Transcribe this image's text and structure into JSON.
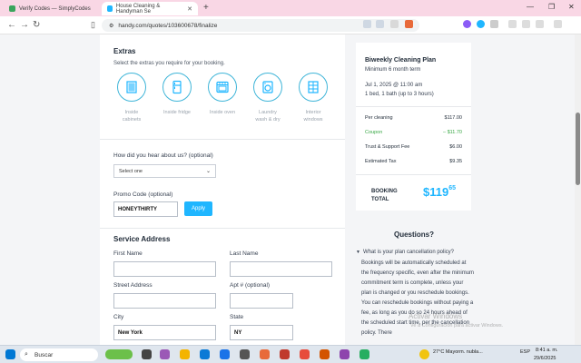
{
  "browser": {
    "tabs": [
      {
        "title": "Verify Codes — SimplyCodes",
        "active": false
      },
      {
        "title": "House Cleaning & Handyman Se",
        "active": true
      }
    ],
    "url": "handy.com/quotes/103600678/finalize"
  },
  "extras": {
    "title": "Extras",
    "subtitle": "Select the extras you require for your booking.",
    "items": [
      {
        "label": "Inside cabinets",
        "icon": "cabinet-icon"
      },
      {
        "label": "Inside fridge",
        "icon": "fridge-icon"
      },
      {
        "label": "Inside oven",
        "icon": "oven-icon"
      },
      {
        "label": "Laundry wash & dry",
        "icon": "laundry-icon"
      },
      {
        "label": "Interior windows",
        "icon": "window-icon"
      }
    ]
  },
  "hear": {
    "label": "How did you hear about us? (optional)",
    "selected": "Select one"
  },
  "promo": {
    "label": "Promo Code (optional)",
    "value": "HONEYTHIRTY",
    "apply": "Apply"
  },
  "service": {
    "title": "Service Address",
    "first_name": "First Name",
    "last_name": "Last Name",
    "street": "Street Address",
    "apt": "Apt # (optional)",
    "city": "City",
    "city_value": "New York",
    "state": "State",
    "state_value": "NY"
  },
  "summary": {
    "plan": "Biweekly Cleaning Plan",
    "term": "Minimum 6 month term",
    "date": "Jul 1, 2025 @ 11:00 am",
    "size": "1 bed, 1 bath (up to 3 hours)",
    "lines": [
      {
        "label": "Per cleaning",
        "value": "$117.00"
      },
      {
        "label": "Coupon",
        "value": "– $11.70"
      },
      {
        "label": "Trust & Support Fee",
        "value": "$6.00"
      },
      {
        "label": "Estimated Tax",
        "value": "$9.35"
      }
    ],
    "total_label_1": "BOOKING",
    "total_label_2": "TOTAL",
    "total_dollars": "$119",
    "total_cents": "65"
  },
  "questions": {
    "title": "Questions?",
    "q1": "What is your plan cancellation policy?",
    "a1": "Bookings will be automatically scheduled at the frequency specific, even after the minimum commitment term is complete, unless your plan is changed or you reschedule bookings. You can reschedule bookings without paying a fee, as long as you do so 24 hours ahead of the scheduled start time, per the cancellation policy. There"
  },
  "watermark": {
    "line1": "Activar Windows",
    "line2": "Ve a Configuración para activar Windows."
  },
  "taskbar": {
    "search": "Buscar",
    "weather": "27°C  Mayorm. nubla...",
    "lang": "ESP",
    "time": "8:41 a. m.",
    "date": "29/6/2025"
  }
}
